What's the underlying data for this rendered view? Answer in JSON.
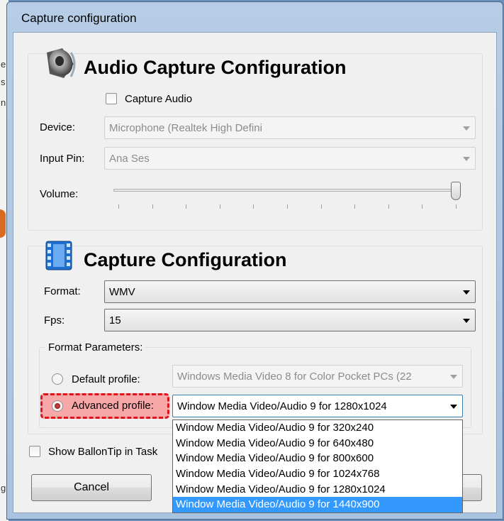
{
  "window": {
    "title": "Capture configuration"
  },
  "background_text": [
    "e",
    "s",
    "n",
    "g"
  ],
  "audio": {
    "header": "Audio Capture Configuration",
    "capture_audio_label": "Capture Audio",
    "capture_audio_checked": false,
    "device_label": "Device:",
    "device_value": "Microphone (Realtek High Defini",
    "input_pin_label": "Input Pin:",
    "input_pin_value": "Ana Ses",
    "volume_label": "Volume:",
    "volume_level": 1.0,
    "volume_ticks": 11
  },
  "capture": {
    "header": "Capture Configuration",
    "format_label": "Format:",
    "format_value": "WMV",
    "fps_label": "Fps:",
    "fps_value": "15",
    "params_title": "Format Parameters:",
    "default_profile_label": "Default profile:",
    "default_profile_value": "Windows Media Video 8 for Color Pocket PCs (22",
    "advanced_profile_label": "Advanced profile:",
    "advanced_profile_value": "Window Media Video/Audio 9 for 1280x1024",
    "selected_profile": "advanced",
    "dropdown_options": [
      "Window Media Video/Audio 9 for 320x240",
      "Window Media Video/Audio 9 for 640x480",
      "Window Media Video/Audio 9 for 800x600",
      "Window Media Video/Audio 9 for 1024x768",
      "Window Media Video/Audio 9 for 1280x1024",
      "Window Media Video/Audio 9 for 1440x900"
    ],
    "highlighted_option": 5
  },
  "footer": {
    "balloon_label": "Show BallonTip in Task",
    "balloon_checked": false,
    "cancel_label": "Cancel"
  },
  "colors": {
    "highlight": "#3399ff",
    "annotation": "#e0101a"
  },
  "icons": {
    "audio": "speaker-icon",
    "video": "film-icon"
  }
}
